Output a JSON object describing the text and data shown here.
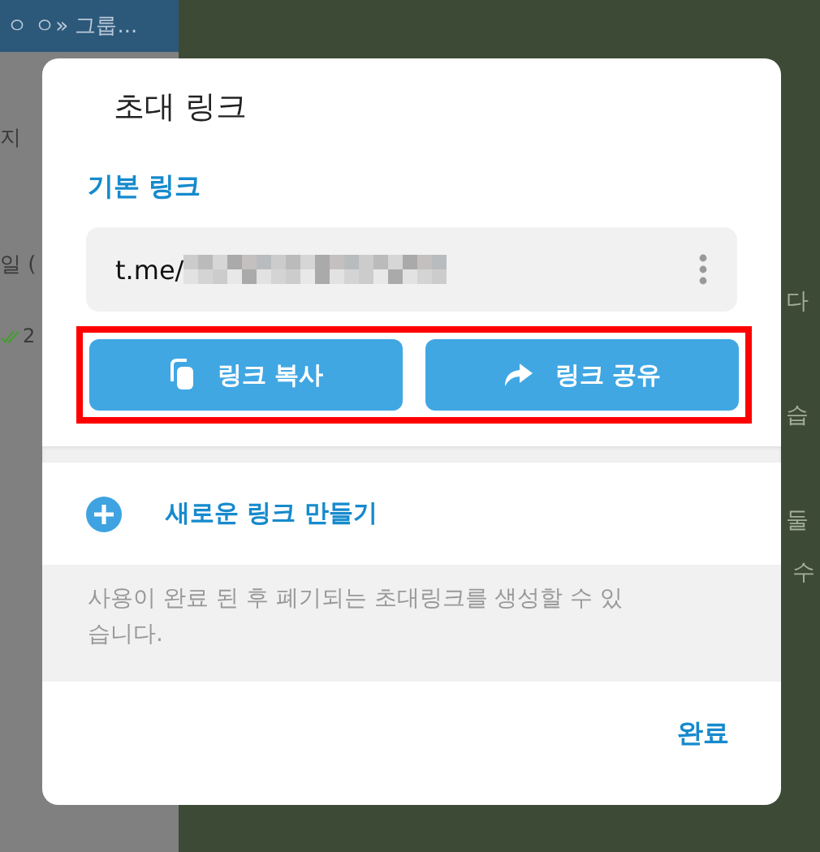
{
  "background": {
    "sidebar_header": "ㅇ ㅇ» 그룹...",
    "sidebar_snippets": [
      "지",
      "일 (",
      "2"
    ],
    "chat_snippets": [
      "다",
      "습",
      "둘",
      "수"
    ]
  },
  "dialog": {
    "title": "초대 링크",
    "section_label": "기본 링크",
    "link_value": "t.me/",
    "buttons": [
      {
        "kind": "copy",
        "label": "링크 복사"
      },
      {
        "kind": "share",
        "label": "링크 공유"
      }
    ],
    "create_link": "새로운 링크 만들기",
    "info": "사용이 완료 된 후 폐기되는 초대링크를 생성할 수 있습니다.",
    "done": "완료"
  }
}
